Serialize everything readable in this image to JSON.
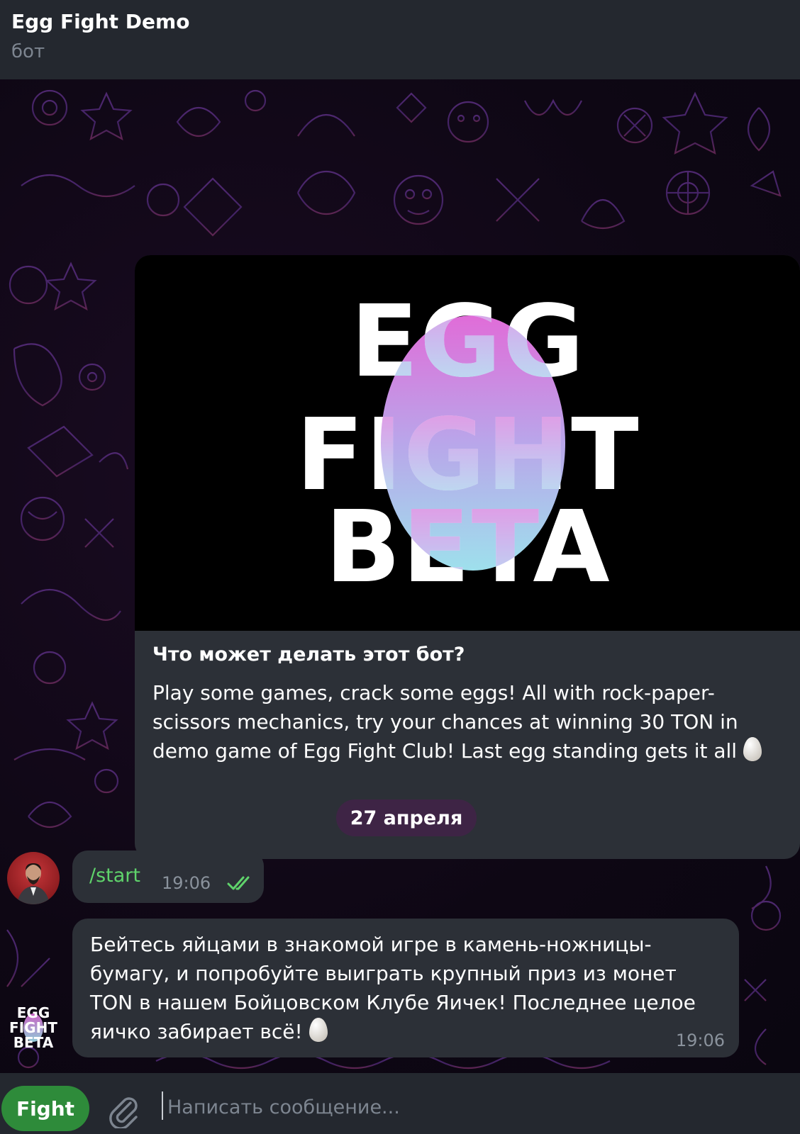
{
  "header": {
    "title": "Egg Fight Demo",
    "subtitle": "бот"
  },
  "intro": {
    "image_lines": [
      "EGG",
      "FIGHT",
      "BETA"
    ],
    "heading": "Что может делать этот бот?",
    "body": "Play some games, crack some eggs! All with rock-paper-scissors mechanics, try your chances at winning 30 TON in demo game of Egg Fight Club! Last egg standing gets it all"
  },
  "date_separator": "27 апреля",
  "messages": [
    {
      "text": "/start",
      "time": "19:06",
      "status": "read"
    },
    {
      "text": "Бейтесь яйцами в знакомой игре в камень-ножницы-бумагу, и попробуйте выиграть крупный приз из монет TON в нашем Бойцовском Клубе Яичек! Последнее целое яичко забирает всё!",
      "time": "19:06"
    }
  ],
  "bot_avatar_lines": [
    "EGG",
    "FIGHT",
    "BETA"
  ],
  "input": {
    "fight_button": "Fight",
    "placeholder": "Написать сообщение..."
  },
  "colors": {
    "header_bg": "#24282f",
    "bubble_bg": "#2c3037",
    "accent_green": "#5fd36b",
    "fight_button": "#2e8b3a",
    "date_pill": "#402446"
  },
  "icons": [
    "egg-emoji-icon",
    "double-check-icon",
    "paperclip-icon"
  ]
}
